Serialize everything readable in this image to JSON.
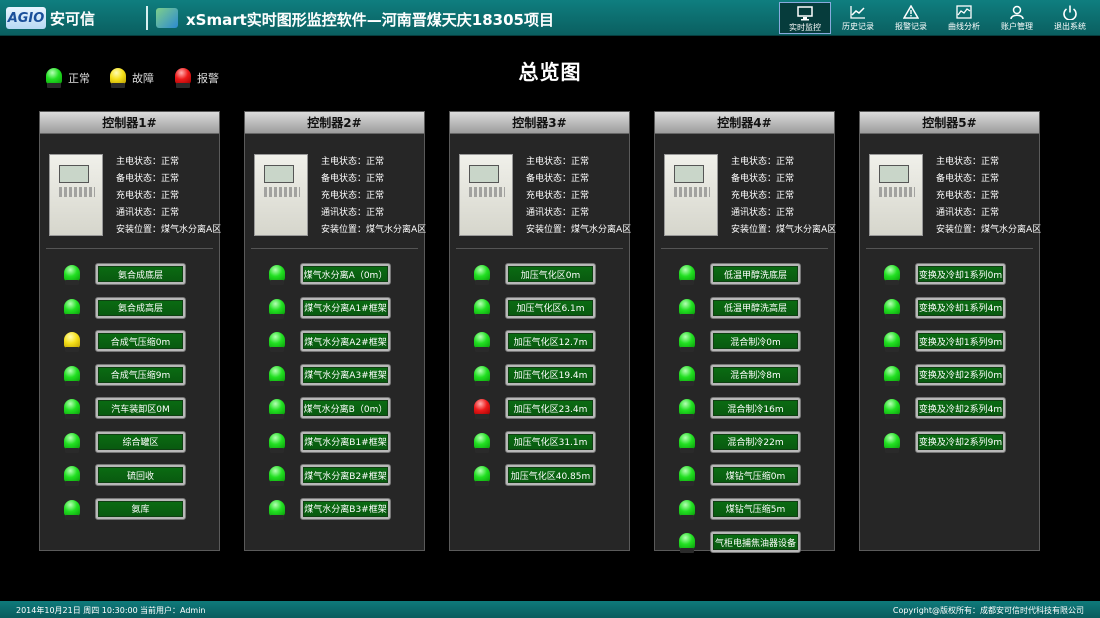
{
  "header": {
    "logo_mark": "AGIO",
    "brand": "安可信",
    "title": "xSmart实时图形监控软件—河南晋煤天庆18305项目",
    "nav": [
      {
        "label": "实时监控",
        "icon": "monitor-icon",
        "active": true
      },
      {
        "label": "历史记录",
        "icon": "line-chart-icon",
        "active": false
      },
      {
        "label": "报警记录",
        "icon": "warning-icon",
        "active": false
      },
      {
        "label": "曲线分析",
        "icon": "curve-chart-icon",
        "active": false
      },
      {
        "label": "账户管理",
        "icon": "user-icon",
        "active": false
      },
      {
        "label": "退出系统",
        "icon": "power-icon",
        "active": false
      }
    ]
  },
  "legend": {
    "normal": "正常",
    "fault": "故障",
    "alarm": "报警"
  },
  "page_title": "总览图",
  "status_labels": {
    "main_power": "主电状态：正常",
    "backup_power": "备电状态：正常",
    "charging": "充电状态：正常",
    "comm": "通讯状态：正常",
    "location": "安装位置：煤气水分离A区"
  },
  "controllers": [
    {
      "title": "控制器1#",
      "points": [
        {
          "label": "氨合成底层",
          "state": "normal"
        },
        {
          "label": "氨合成高层",
          "state": "normal"
        },
        {
          "label": "合成气压缩0m",
          "state": "fault"
        },
        {
          "label": "合成气压缩9m",
          "state": "normal"
        },
        {
          "label": "汽车装卸区0M",
          "state": "normal"
        },
        {
          "label": "综合罐区",
          "state": "normal"
        },
        {
          "label": "硫回收",
          "state": "normal"
        },
        {
          "label": "氨库",
          "state": "normal"
        }
      ]
    },
    {
      "title": "控制器2#",
      "points": [
        {
          "label": "煤气水分离A（0m）",
          "state": "normal"
        },
        {
          "label": "煤气水分离A1#框架",
          "state": "normal"
        },
        {
          "label": "煤气水分离A2#框架",
          "state": "normal"
        },
        {
          "label": "煤气水分离A3#框架",
          "state": "normal"
        },
        {
          "label": "煤气水分离B（0m）",
          "state": "normal"
        },
        {
          "label": "煤气水分离B1#框架",
          "state": "normal"
        },
        {
          "label": "煤气水分离B2#框架",
          "state": "normal"
        },
        {
          "label": "煤气水分离B3#框架",
          "state": "normal"
        }
      ]
    },
    {
      "title": "控制器3#",
      "points": [
        {
          "label": "加压气化区0m",
          "state": "normal"
        },
        {
          "label": "加压气化区6.1m",
          "state": "normal"
        },
        {
          "label": "加压气化区12.7m",
          "state": "normal"
        },
        {
          "label": "加压气化区19.4m",
          "state": "normal"
        },
        {
          "label": "加压气化区23.4m",
          "state": "alarm"
        },
        {
          "label": "加压气化区31.1m",
          "state": "normal"
        },
        {
          "label": "加压气化区40.85m",
          "state": "normal"
        }
      ]
    },
    {
      "title": "控制器4#",
      "points": [
        {
          "label": "低温甲醇洗底层",
          "state": "normal"
        },
        {
          "label": "低温甲醇洗高层",
          "state": "normal"
        },
        {
          "label": "混合制冷0m",
          "state": "normal"
        },
        {
          "label": "混合制冷8m",
          "state": "normal"
        },
        {
          "label": "混合制冷16m",
          "state": "normal"
        },
        {
          "label": "混合制冷22m",
          "state": "normal"
        },
        {
          "label": "煤钻气压缩0m",
          "state": "normal"
        },
        {
          "label": "煤钻气压缩5m",
          "state": "normal"
        },
        {
          "label": "气柜电捕焦油器设备",
          "state": "normal"
        }
      ]
    },
    {
      "title": "控制器5#",
      "points": [
        {
          "label": "变换及冷却1系列0m",
          "state": "normal"
        },
        {
          "label": "变换及冷却1系列4m",
          "state": "normal"
        },
        {
          "label": "变换及冷却1系列9m",
          "state": "normal"
        },
        {
          "label": "变换及冷却2系列0m",
          "state": "normal"
        },
        {
          "label": "变换及冷却2系列4m",
          "state": "normal"
        },
        {
          "label": "变换及冷却2系列9m",
          "state": "normal"
        }
      ]
    }
  ],
  "footer": {
    "datetime": "2014年10月21日 周四  10:30:00",
    "user": "当前用户：Admin",
    "copyright": "Copyright@版权所有：成都安可信时代科技有限公司"
  },
  "colors": {
    "normal": "#22e022",
    "fault": "#f5e01a",
    "alarm": "#ee1a1a",
    "header": "#0f7e7f"
  }
}
